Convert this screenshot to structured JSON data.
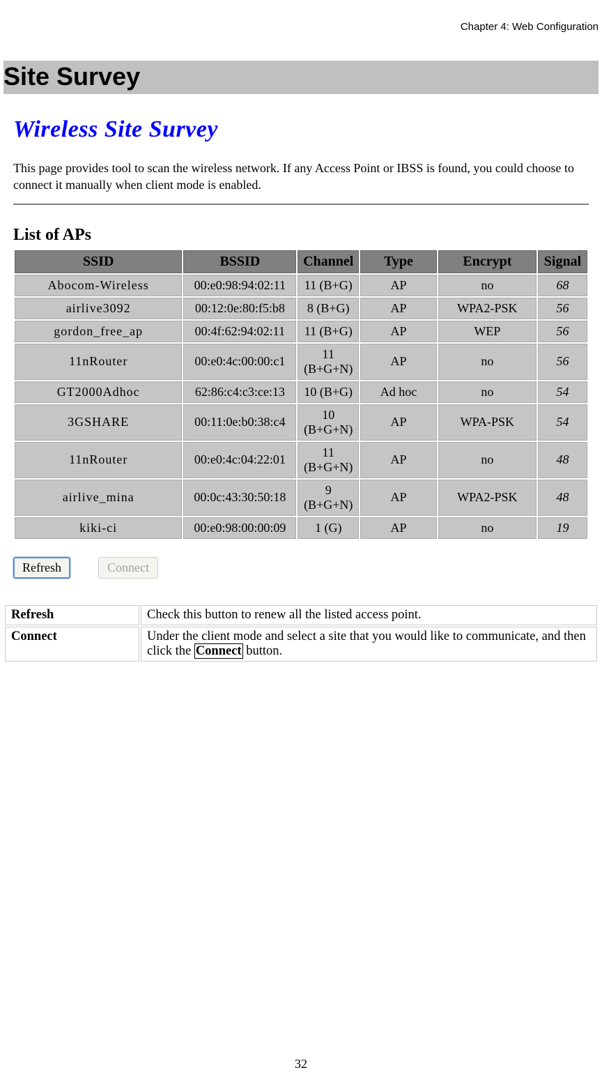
{
  "chapter": "Chapter 4: Web Configuration",
  "section_title": "Site Survey",
  "wireless_title": "Wireless Site Survey",
  "intro_text": "This page provides tool to scan the wireless network. If any Access Point or IBSS is found, you could choose to connect it manually when client mode is enabled.",
  "list_heading": "List of APs",
  "columns": {
    "ssid": "SSID",
    "bssid": "BSSID",
    "channel": "Channel",
    "type": "Type",
    "encrypt": "Encrypt",
    "signal": "Signal"
  },
  "aps": [
    {
      "ssid": "Abocom-Wireless",
      "bssid": "00:e0:98:94:02:11",
      "channel": "11 (B+G)",
      "type": "AP",
      "encrypt": "no",
      "signal": "68"
    },
    {
      "ssid": "airlive3092",
      "bssid": "00:12:0e:80:f5:b8",
      "channel": "8 (B+G)",
      "type": "AP",
      "encrypt": "WPA2-PSK",
      "signal": "56"
    },
    {
      "ssid": "gordon_free_ap",
      "bssid": "00:4f:62:94:02:11",
      "channel": "11 (B+G)",
      "type": "AP",
      "encrypt": "WEP",
      "signal": "56"
    },
    {
      "ssid": "11nRouter",
      "bssid": "00:e0:4c:00:00:c1",
      "channel": "11 (B+G+N)",
      "type": "AP",
      "encrypt": "no",
      "signal": "56"
    },
    {
      "ssid": "GT2000Adhoc",
      "bssid": "62:86:c4:c3:ce:13",
      "channel": "10 (B+G)",
      "type": "Ad hoc",
      "encrypt": "no",
      "signal": "54"
    },
    {
      "ssid": "3GSHARE",
      "bssid": "00:11:0e:b0:38:c4",
      "channel": "10 (B+G+N)",
      "type": "AP",
      "encrypt": "WPA-PSK",
      "signal": "54"
    },
    {
      "ssid": "11nRouter",
      "bssid": "00:e0:4c:04:22:01",
      "channel": "11 (B+G+N)",
      "type": "AP",
      "encrypt": "no",
      "signal": "48"
    },
    {
      "ssid": "airlive_mina",
      "bssid": "00:0c:43:30:50:18",
      "channel": "9 (B+G+N)",
      "type": "AP",
      "encrypt": "WPA2-PSK",
      "signal": "48"
    },
    {
      "ssid": "kiki-ci",
      "bssid": "00:e0:98:00:00:09",
      "channel": "1 (G)",
      "type": "AP",
      "encrypt": "no",
      "signal": "19"
    }
  ],
  "buttons": {
    "refresh": "Refresh",
    "connect": "Connect"
  },
  "desc": {
    "refresh_term": "Refresh",
    "refresh_text": "Check this button to renew all the listed access point.",
    "connect_term": "Connect",
    "connect_text_pre": "Under the client mode and select a site that you would like to communicate, and then click the ",
    "connect_boxed": "Connect",
    "connect_text_post": " button."
  },
  "page_number": "32"
}
